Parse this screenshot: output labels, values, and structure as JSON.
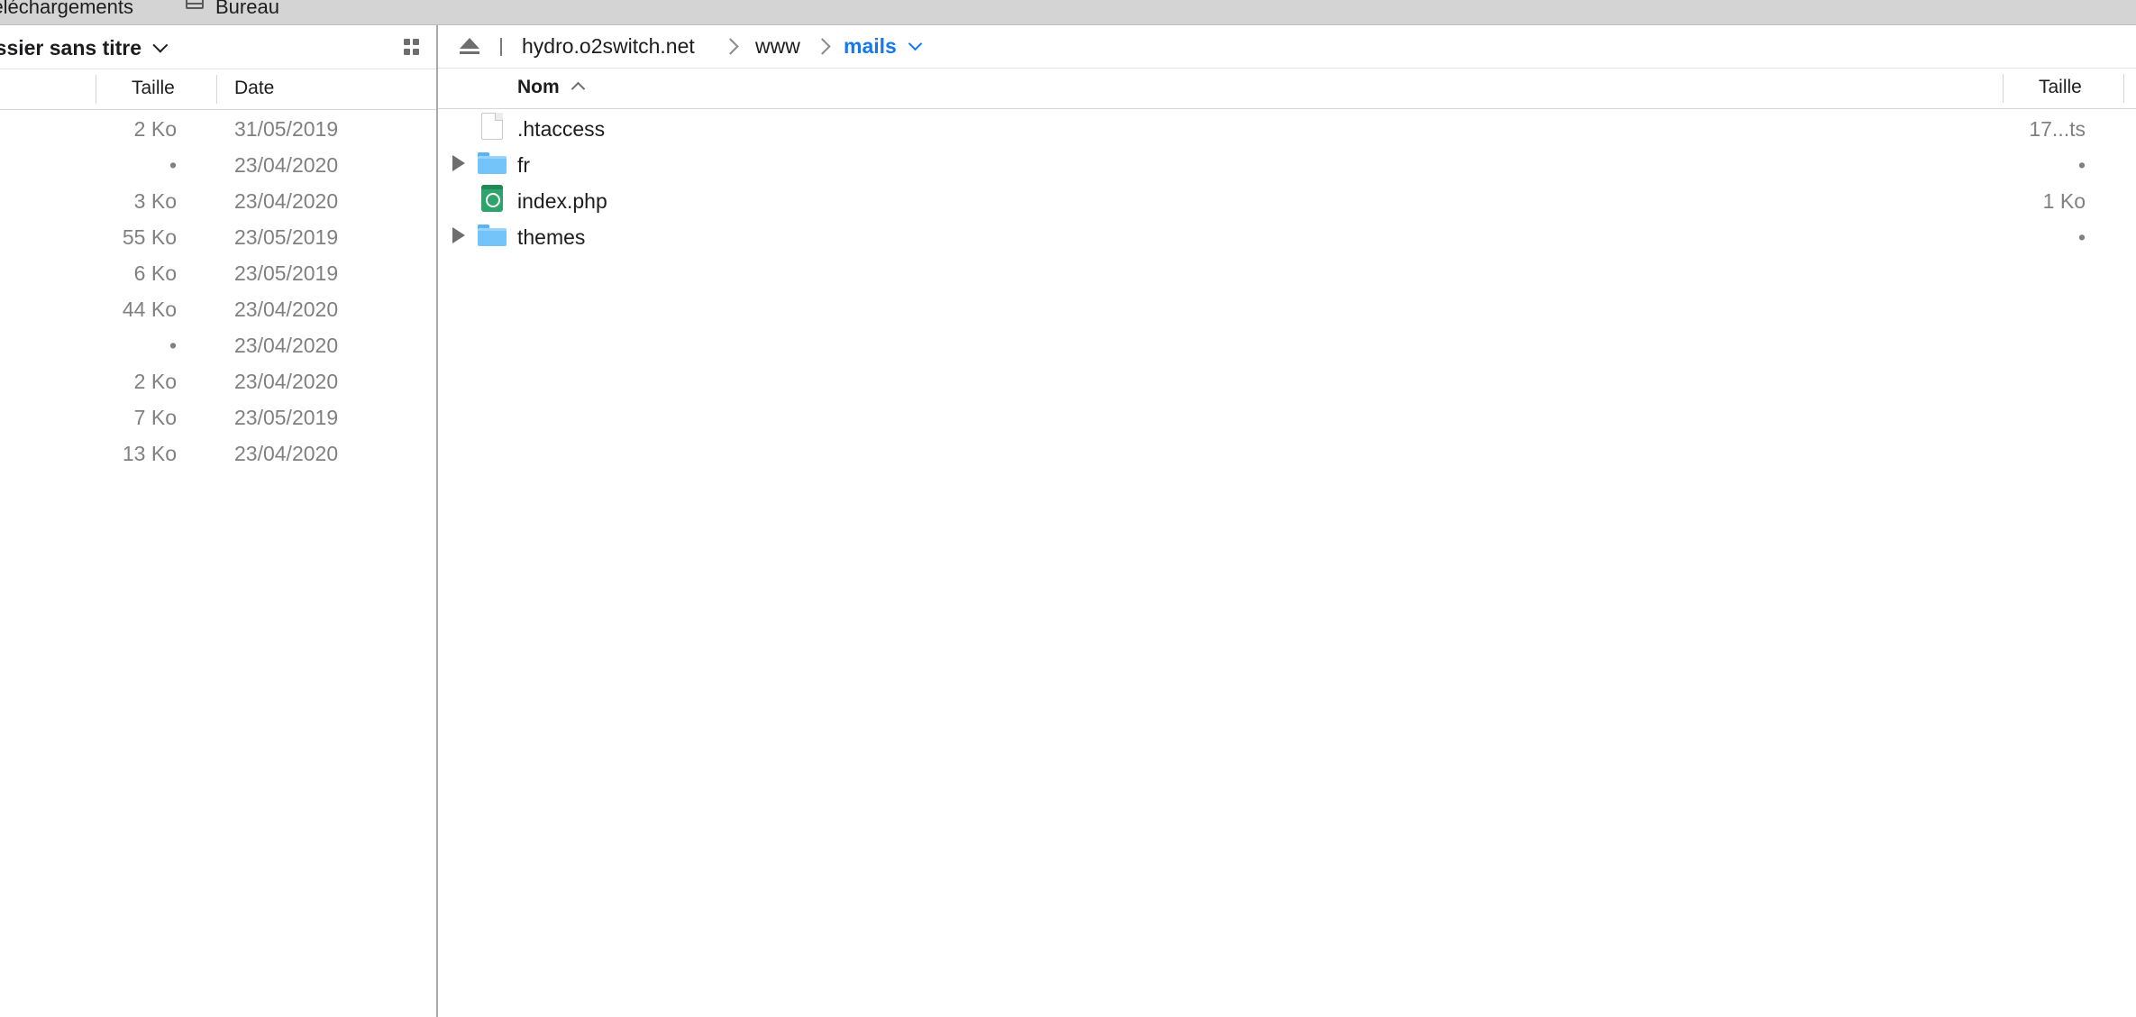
{
  "bookmarks": [
    {
      "label": "Téléchargements"
    },
    {
      "label": "Bureau",
      "icon": "folder-icon"
    }
  ],
  "left_pane": {
    "path_label": "Dossier sans titre",
    "view_icon": "grid-view-icon",
    "columns": {
      "size": "Taille",
      "date": "Date"
    },
    "rows": [
      {
        "size": "2 Ko",
        "date": "31/05/2019"
      },
      {
        "size": "•",
        "date": "23/04/2020"
      },
      {
        "size": "3 Ko",
        "date": "23/04/2020"
      },
      {
        "size": "55 Ko",
        "date": "23/05/2019"
      },
      {
        "size": "6 Ko",
        "date": "23/05/2019"
      },
      {
        "size": "44 Ko",
        "date": "23/04/2020"
      },
      {
        "size": "•",
        "date": "23/04/2020"
      },
      {
        "size": "2 Ko",
        "date": "23/04/2020"
      },
      {
        "size": "7 Ko",
        "date": "23/05/2019"
      },
      {
        "size": "13 Ko",
        "date": "23/04/2020"
      }
    ]
  },
  "right_pane": {
    "breadcrumb": {
      "host": "hydro.o2switch.net",
      "folder": "www",
      "current": "mails"
    },
    "columns": {
      "name": "Nom",
      "size": "Taille"
    },
    "files": [
      {
        "name": ".htaccess",
        "size": "17...ts",
        "kind": "document",
        "expandable": false
      },
      {
        "name": "fr",
        "size": "•",
        "kind": "folder",
        "expandable": true
      },
      {
        "name": "index.php",
        "size": "1 Ko",
        "kind": "php",
        "expandable": false
      },
      {
        "name": "themes",
        "size": "•",
        "kind": "folder",
        "expandable": true
      }
    ]
  },
  "colors": {
    "accent": "#1479f1",
    "folder": "#74c4fa",
    "php": "#2ea36b"
  }
}
